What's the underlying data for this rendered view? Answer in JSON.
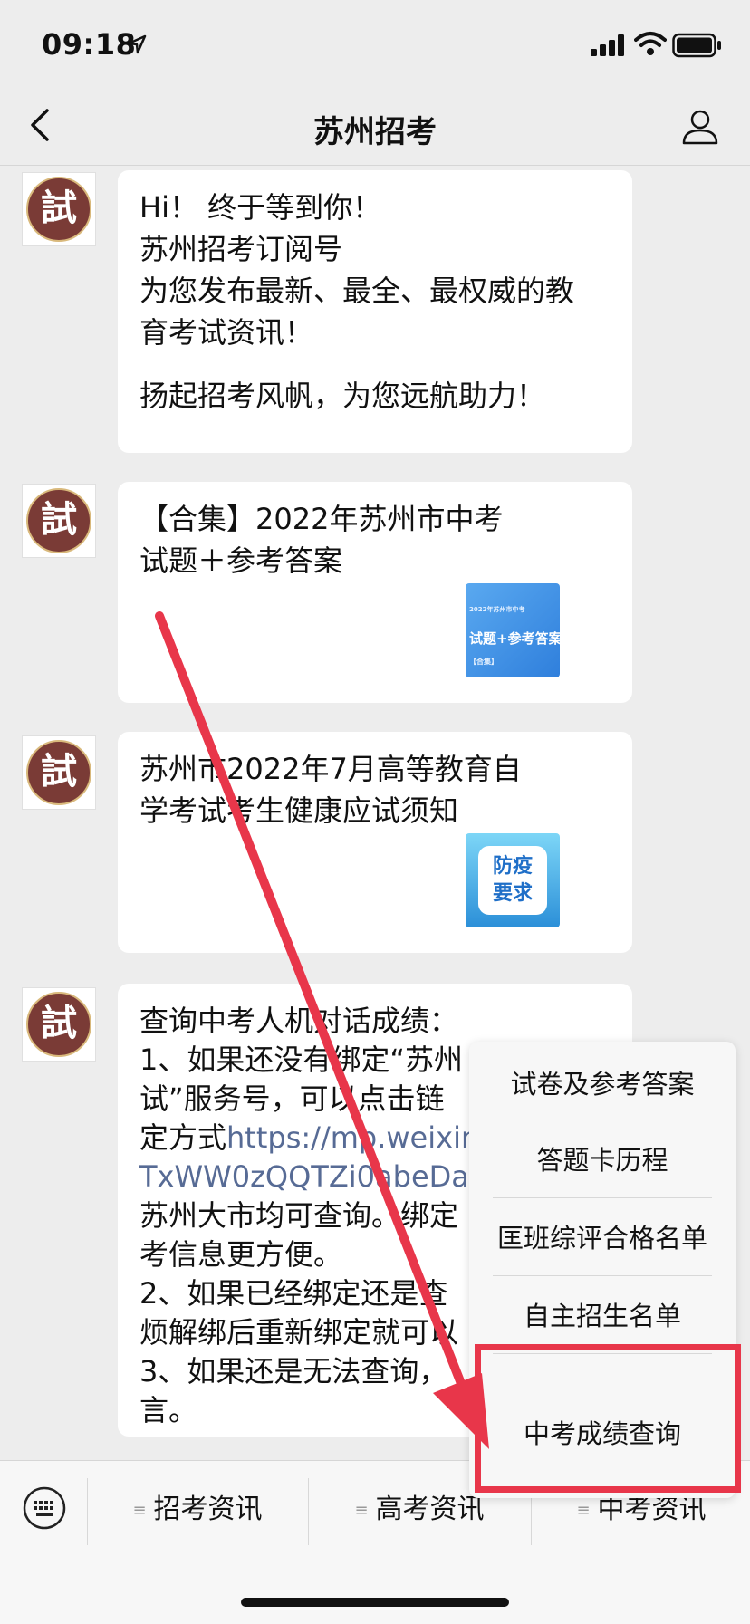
{
  "status_bar": {
    "time": "09:18"
  },
  "nav": {
    "title": "苏州招考"
  },
  "avatar_char": "試",
  "messages": {
    "welcome": {
      "line1": "Hi！ 终于等到你！",
      "line2": "苏州招考订阅号",
      "line3": "为您发布最新、最全、最权威的教",
      "line4": "育考试资讯！",
      "line5": "扬起招考风帆，为您远航助力！"
    },
    "article1": {
      "line1": "【合集】2022年苏州市中考",
      "line2": "试题＋参考答案",
      "thumb_small": "2022年苏州市中考",
      "thumb_main": "试题+参考答案",
      "thumb_tag": "【合集】"
    },
    "article2": {
      "line1": "苏州市2022年7月高等教育自",
      "line2": "学考试考生健康应试须知",
      "thumb_line1": "防疫",
      "thumb_line2": "要求"
    },
    "notice": {
      "line1": "查询中考人机对话成绩：",
      "line2": "1、如果还没有绑定“苏州",
      "line3": "试”服务号，可以点击链",
      "line4a": "定方式",
      "line4_link": "https://mp.weixin.",
      "line5_link": "TxWW0zQQTZi0abeDar",
      "line6": "苏州大市均可查询。绑定",
      "line7": "考信息更方便。",
      "line8": "2、如果已经绑定还是查",
      "line9": "烦解绑后重新绑定就可以",
      "line10": "3、如果还是无法查询，",
      "line11": "言。"
    }
  },
  "menu": {
    "items": [
      "试卷及参考答案",
      "答题卡历程",
      "匡班综评合格名单",
      "自主招生名单",
      "中考成绩查询"
    ]
  },
  "tabbar": {
    "tabs": [
      "招考资讯",
      "高考资讯",
      "中考资讯"
    ]
  },
  "colors": {
    "highlight": "#e8364a",
    "arrow": "#e8364a",
    "link": "#576b95"
  }
}
